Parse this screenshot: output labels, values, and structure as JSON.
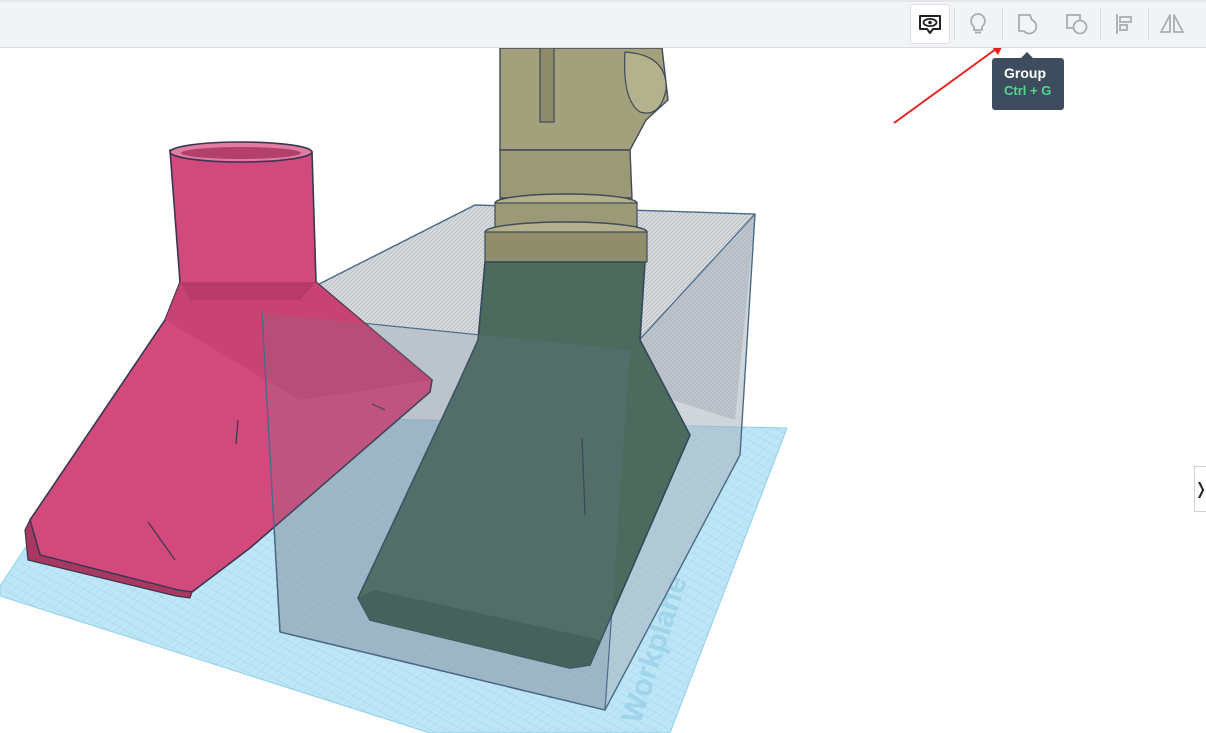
{
  "toolbar": {
    "buttons": [
      {
        "name": "show-all",
        "icon": "eye-speech-icon",
        "active": true
      },
      {
        "name": "notes",
        "icon": "lightbulb-icon",
        "active": false
      },
      {
        "name": "group",
        "icon": "group-shapes-icon",
        "active": false
      },
      {
        "name": "ungroup",
        "icon": "ungroup-shapes-icon",
        "active": false
      },
      {
        "name": "align",
        "icon": "align-icon",
        "active": false
      },
      {
        "name": "mirror",
        "icon": "mirror-icon",
        "active": false
      }
    ]
  },
  "tooltip": {
    "title": "Group",
    "shortcut": "Ctrl + G",
    "shortcut_color": "#4fd890",
    "background": "#3d4d5e"
  },
  "annotation": {
    "arrow_color": "#e82020"
  },
  "workplane": {
    "label": "Workplane",
    "color": "#b7e3f5"
  },
  "shapes": [
    {
      "name": "pink-funnel",
      "color": "#d24a7c"
    },
    {
      "name": "olive-nozzle",
      "color": "#9a9a76"
    },
    {
      "name": "hole-box",
      "color": "#7a8a9a"
    }
  ],
  "side_panel": {
    "toggle_glyph": "❭"
  }
}
